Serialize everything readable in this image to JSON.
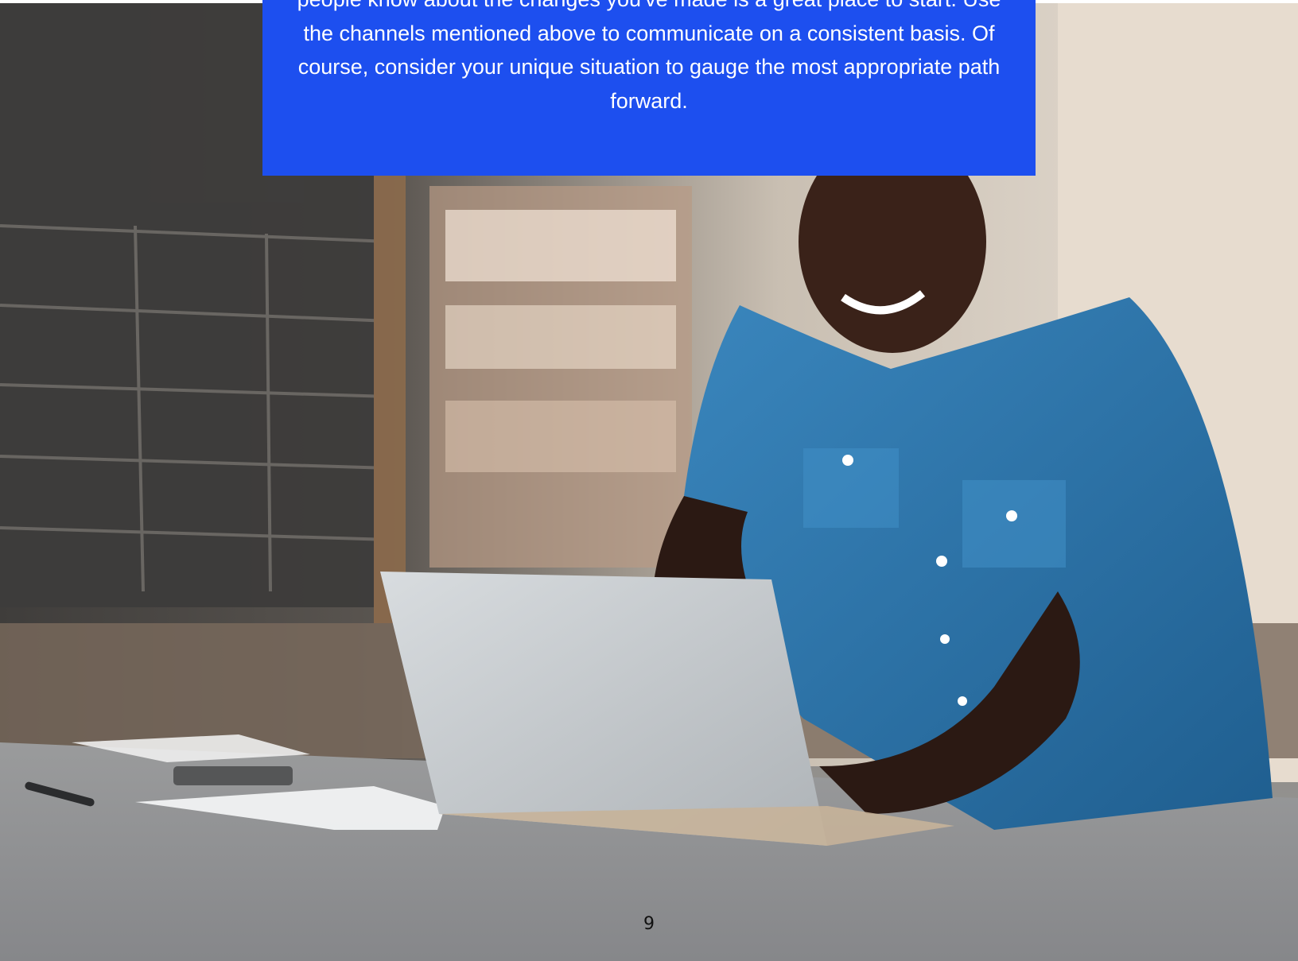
{
  "callout": {
    "text": "people know about the changes you've made is a great place to start. Use the channels mentioned above to communicate on a consistent basis. Of course, consider your unique situation to gauge the most appropriate path forward."
  },
  "page": {
    "number": "9"
  },
  "colors": {
    "callout_background": "#1d4fef",
    "callout_text": "#ffffff",
    "shirt": "#2f78ad",
    "laptop": "#c3c7ca",
    "table": "#8f9091"
  },
  "photo": {
    "subject": "man in denim shirt smiling while typing on a laptop at a workshop counter"
  }
}
